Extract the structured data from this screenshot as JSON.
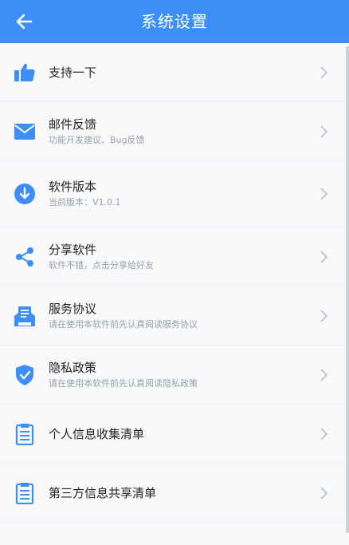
{
  "header": {
    "title": "系统设置",
    "back_icon": "arrow-left-icon",
    "color": "#3e8ef7"
  },
  "items": [
    {
      "label": "支持一下",
      "sub": "",
      "icon": "thumbs-up-icon"
    },
    {
      "label": "邮件反馈",
      "sub": "功能开发建议、Bug反馈",
      "icon": "mail-icon"
    },
    {
      "label": "软件版本",
      "sub": "当前版本：V1.0.1",
      "icon": "download-icon"
    },
    {
      "label": "分享软件",
      "sub": "软件不错，点击分享给好友",
      "icon": "share-icon"
    },
    {
      "label": "服务协议",
      "sub": "请在使用本软件前先认真阅读服务协议",
      "icon": "document-icon"
    },
    {
      "label": "隐私政策",
      "sub": "请在使用本软件前先认真阅读隐私政策",
      "icon": "shield-check-icon"
    },
    {
      "label": "个人信息收集清单",
      "sub": "",
      "icon": "clipboard-icon"
    },
    {
      "label": "第三方信息共享清单",
      "sub": "",
      "icon": "clipboard-icon"
    }
  ],
  "accent": "#3e8ef7"
}
